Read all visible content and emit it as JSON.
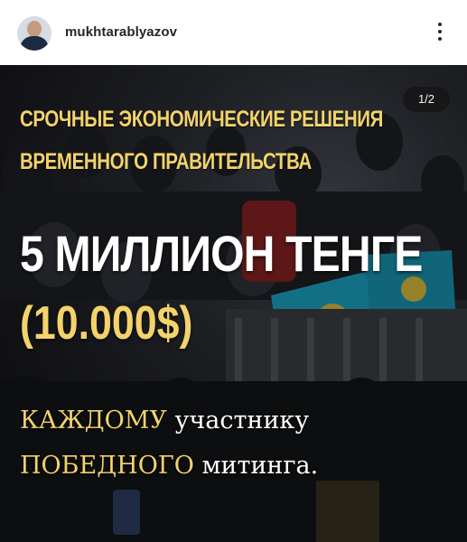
{
  "post": {
    "username": "mukhtarablyazov",
    "counter": "1/2",
    "headline_line1": "СРОЧНЫЕ ЭКОНОМИЧЕСКИЕ РЕШЕНИЯ",
    "headline_line2": "ВРЕМЕННОГО ПРАВИТЕЛЬСТВА",
    "amount": "5 МИЛЛИОН ТЕНГЕ",
    "amount_usd": "(10.000$)",
    "line1_accent": "КАЖДОМУ",
    "line1_rest": " участнику",
    "line2_accent": "ПОБЕДНОГО",
    "line2_rest": " митинга."
  },
  "icons": {
    "avatar": "profile-photo",
    "more": "more-options-icon"
  },
  "colors": {
    "accent": "#f3d36a",
    "text": "#ffffff",
    "flag": "#1aa8c7"
  }
}
